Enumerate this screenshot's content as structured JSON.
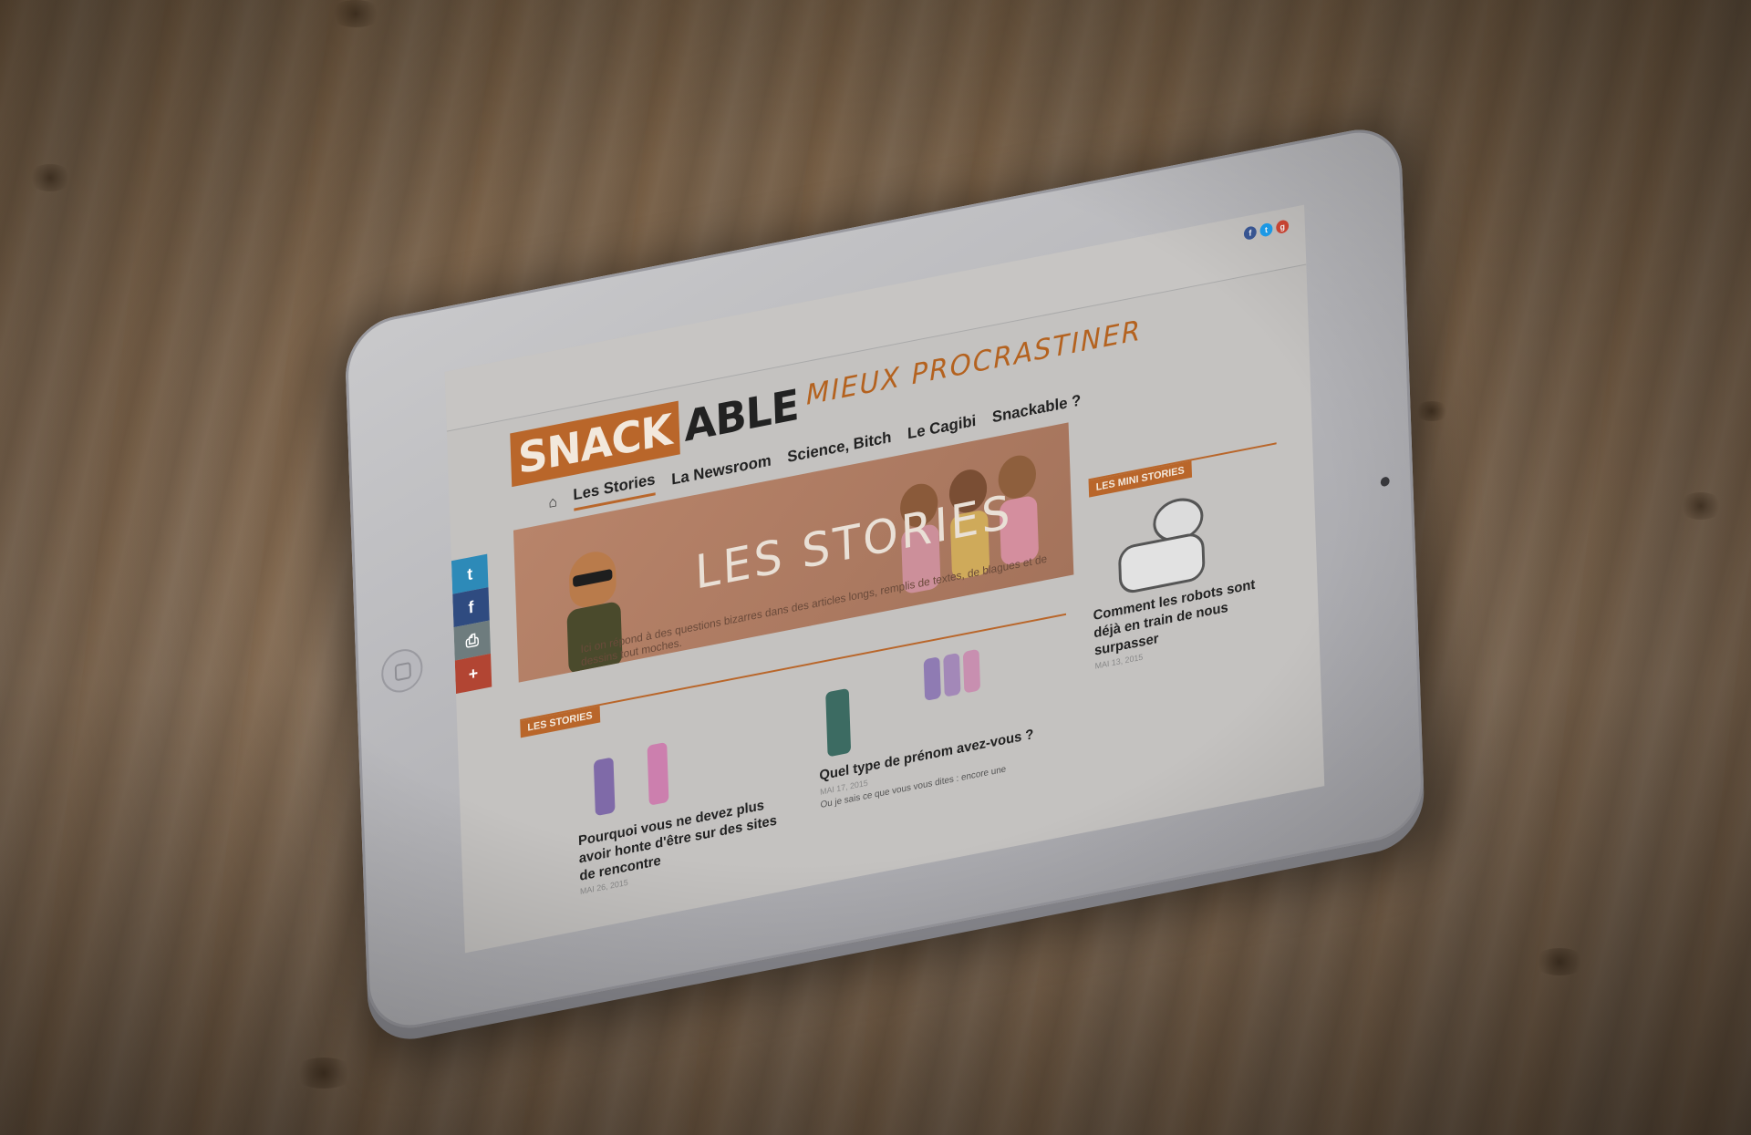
{
  "site": {
    "logo_part1": "SNACK",
    "logo_part2": "ABLE",
    "tagline": "MIEUX PROCRASTINER"
  },
  "social_top": [
    "f",
    "t",
    "g"
  ],
  "nav": {
    "home_icon": "home-icon",
    "items": [
      "Les Stories",
      "La Newsroom",
      "Science, Bitch",
      "Le Cagibi",
      "Snackable ?"
    ]
  },
  "side_share": [
    "twitter-icon",
    "facebook-icon",
    "print-icon",
    "plus-icon"
  ],
  "hero": {
    "title": "LES STORIES",
    "description": "Ici on répond à des questions bizarres dans des articles longs, remplis de textes, de blagues et de dessins tout moches."
  },
  "sections": {
    "stories_label": "LES STORIES",
    "mini_stories_label": "LES MINI STORIES"
  },
  "stories": [
    {
      "title": "Pourquoi vous ne devez plus avoir honte d'être sur des sites de rencontre",
      "date": "MAI 26, 2015"
    },
    {
      "title": "Quel type de prénom avez-vous ?",
      "date": "MAI 17, 2015",
      "excerpt": "Ou je sais ce que vous vous dites : encore une"
    }
  ],
  "mini_stories": [
    {
      "title": "Comment les robots sont déjà en train de nous surpasser",
      "date": "MAI 13, 2015"
    }
  ],
  "colors": {
    "brand_orange": "#b9662a",
    "twitter": "#1da1f2",
    "facebook": "#3b5998",
    "google": "#d34836"
  }
}
